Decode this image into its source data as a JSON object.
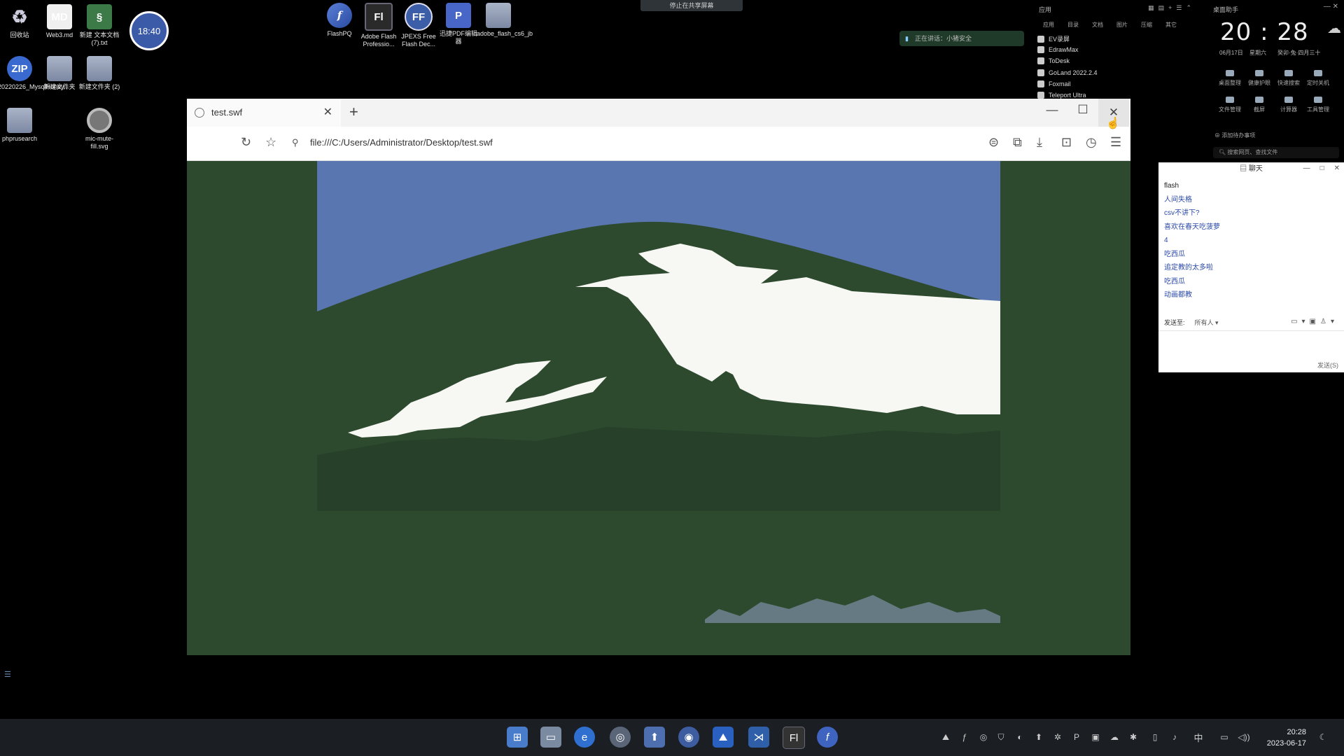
{
  "desktop": {
    "icons": [
      {
        "label": "回收站",
        "glyph": "♻"
      },
      {
        "label": "Web3.md",
        "glyph": "MD"
      },
      {
        "label": "新建 文本文档 (7).txt",
        "glyph": "§"
      },
      {
        "label": "20220226_MysqlHoney...",
        "glyph": "ZIP"
      },
      {
        "label": "新建文件夹",
        "glyph": ""
      },
      {
        "label": "新建文件夹 (2)",
        "glyph": ""
      },
      {
        "label": "phprusearch",
        "glyph": ""
      },
      {
        "label": "mic-mute-fill.svg",
        "glyph": ""
      },
      {
        "label": "FlashPQ",
        "glyph": "f"
      },
      {
        "label": "Adobe Flash Professio...",
        "glyph": "Fl"
      },
      {
        "label": "JPEXS Free Flash Dec...",
        "glyph": "FF"
      },
      {
        "label": "迅捷PDF编辑器",
        "glyph": "P"
      },
      {
        "label": "adobe_flash_cs6_jb",
        "glyph": ""
      }
    ],
    "float_clock": "18:40",
    "share_hint": "停止在共享屏幕",
    "voice_pill": "正在讲话：小猪安全"
  },
  "apps_panel": {
    "title": "应用",
    "tabs": [
      "应用",
      "目录",
      "文档",
      "图片",
      "压缩",
      "其它"
    ],
    "items": [
      "EV录屏",
      "EdrawMax",
      "ToDesk",
      "GoLand 2022.2.4",
      "Foxmail",
      "Teleport Ultra"
    ]
  },
  "clock_widget": {
    "title": "桌面助手",
    "time": "20 : 28",
    "date": "06月17日",
    "weekday": "星期六",
    "lunar": "癸卯·兔·四月三十",
    "buttons_row1": [
      "桌面整理",
      "健康护眼",
      "快速搜索",
      "定时关机"
    ],
    "buttons_row2": [
      "文件管理",
      "截屏",
      "计算器",
      "工具管理"
    ],
    "todo": "添加待办事项",
    "search": "搜索网页、查找文件"
  },
  "chat": {
    "title": "聊天",
    "messages": [
      "flash",
      "人间失格",
      "csv不讲下?",
      "喜欢在春天吃菠萝",
      "4",
      "吃西瓜",
      "追定教的太多啦",
      "吃西瓜",
      "动画都教"
    ],
    "send_to_label": "发送至:",
    "send_to_value": "所有人 ▾",
    "send_button": "发送(S)"
  },
  "browser": {
    "tab_title": "test.swf",
    "url": "file:///C:/Users/Administrator/Desktop/test.swf"
  },
  "taskbar": {
    "time": "20:28",
    "date": "2023-06-17",
    "ime": "中"
  },
  "colors": {
    "sky": "#5a76b0",
    "mountain_dark": "#2d4a2e",
    "snow": "#f7f8f4",
    "grass_dark": "#26402a",
    "accent": "#3b5aa8"
  }
}
